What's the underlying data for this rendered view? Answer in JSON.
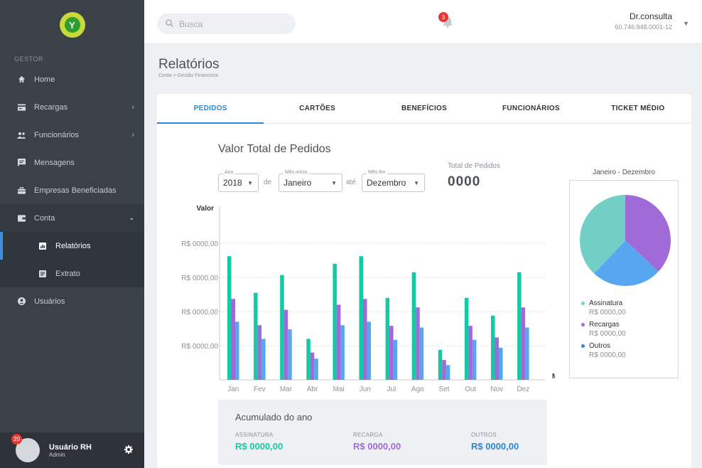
{
  "app": {
    "logo_letter": "Y"
  },
  "colors": {
    "assinatura": "#14c9a4",
    "assinatura_pie": "#71cfc5",
    "recargas": "#a06bd8",
    "outros": "#56a7ef",
    "outros_text": "#2f86d1",
    "accent": "#2f86d1"
  },
  "sidebar": {
    "section": "GESTOR",
    "items": [
      {
        "label": "Home",
        "icon": "home-icon"
      },
      {
        "label": "Recargas",
        "icon": "credit-card-icon"
      },
      {
        "label": "Funcionários",
        "icon": "people-icon"
      },
      {
        "label": "Mensagens",
        "icon": "message-icon"
      },
      {
        "label": "Empresas Beneficiadas",
        "icon": "briefcase-icon"
      },
      {
        "label": "Conta",
        "icon": "wallet-icon"
      },
      {
        "label": "Usuários",
        "icon": "user-circle-icon"
      }
    ],
    "sub_items": [
      {
        "label": "Relatórios",
        "icon": "report-icon"
      },
      {
        "label": "Extrato",
        "icon": "statement-icon"
      }
    ],
    "user": {
      "name": "Usuário RH",
      "role": "Admin",
      "badge": "20"
    }
  },
  "header": {
    "search_placeholder": "Busca",
    "notifications": "3",
    "account_name": "Dr.consulta",
    "account_id": "60.746.948.0001-12"
  },
  "page": {
    "title": "Relatórios",
    "breadcrumb": "Conta > Gestão Financeira"
  },
  "tabs": [
    "PEDIDOS",
    "CARTÕES",
    "BENEFÍCIOS",
    "FUNCIONÁRIOS",
    "TICKET MÉDIO"
  ],
  "filters": {
    "ano_label": "Ano",
    "ano_value": "2018",
    "de": "de",
    "inicio_label": "Mês início",
    "inicio_value": "Janeiro",
    "ate": "até",
    "fim_label": "Mês fim",
    "fim_value": "Dezembro"
  },
  "total": {
    "label": "Total de Pedidos",
    "value": "0000"
  },
  "chart_data": [
    {
      "type": "bar",
      "title": "Valor Total de Pedidos",
      "ylabel": "Valor",
      "xlabel": "Mês",
      "categories": [
        "Jan",
        "Fev",
        "Mar",
        "Abr",
        "Mai",
        "Jun",
        "Jul",
        "Ago",
        "Set",
        "Out",
        "Nov",
        "Dez"
      ],
      "y_tick_labels": [
        "R$ 0000,00",
        "R$ 0000,00",
        "R$ 0000,00",
        "R$ 0000,00"
      ],
      "ylim": [
        0,
        4
      ],
      "grid": true,
      "series": [
        {
          "name": "Assinatura",
          "values": [
            3.62,
            2.55,
            3.07,
            1.2,
            3.4,
            3.62,
            2.4,
            3.15,
            0.88,
            2.4,
            1.88,
            3.15
          ]
        },
        {
          "name": "Recargas",
          "values": [
            2.37,
            1.6,
            2.05,
            0.8,
            2.2,
            2.37,
            1.58,
            2.12,
            0.58,
            1.58,
            1.24,
            2.12
          ]
        },
        {
          "name": "Outros",
          "values": [
            1.7,
            1.2,
            1.48,
            0.62,
            1.6,
            1.7,
            1.17,
            1.53,
            0.43,
            1.17,
            0.94,
            1.53
          ]
        }
      ]
    },
    {
      "type": "pie",
      "title": "Janeiro - Dezembro",
      "categories": [
        "Assinatura",
        "Recargas",
        "Outros"
      ],
      "values": [
        38,
        37,
        25
      ],
      "value_labels": [
        "R$ 0000,00",
        "R$ 0000,00",
        "R$ 0000,00"
      ]
    }
  ],
  "acumulado": {
    "title": "Acumulado do ano",
    "items": [
      {
        "label": "ASSINATURA",
        "value": "R$ 0000,00"
      },
      {
        "label": "RECARGA",
        "value": "R$ 0000,00"
      },
      {
        "label": "OUTROS",
        "value": "R$ 0000,00"
      }
    ]
  }
}
